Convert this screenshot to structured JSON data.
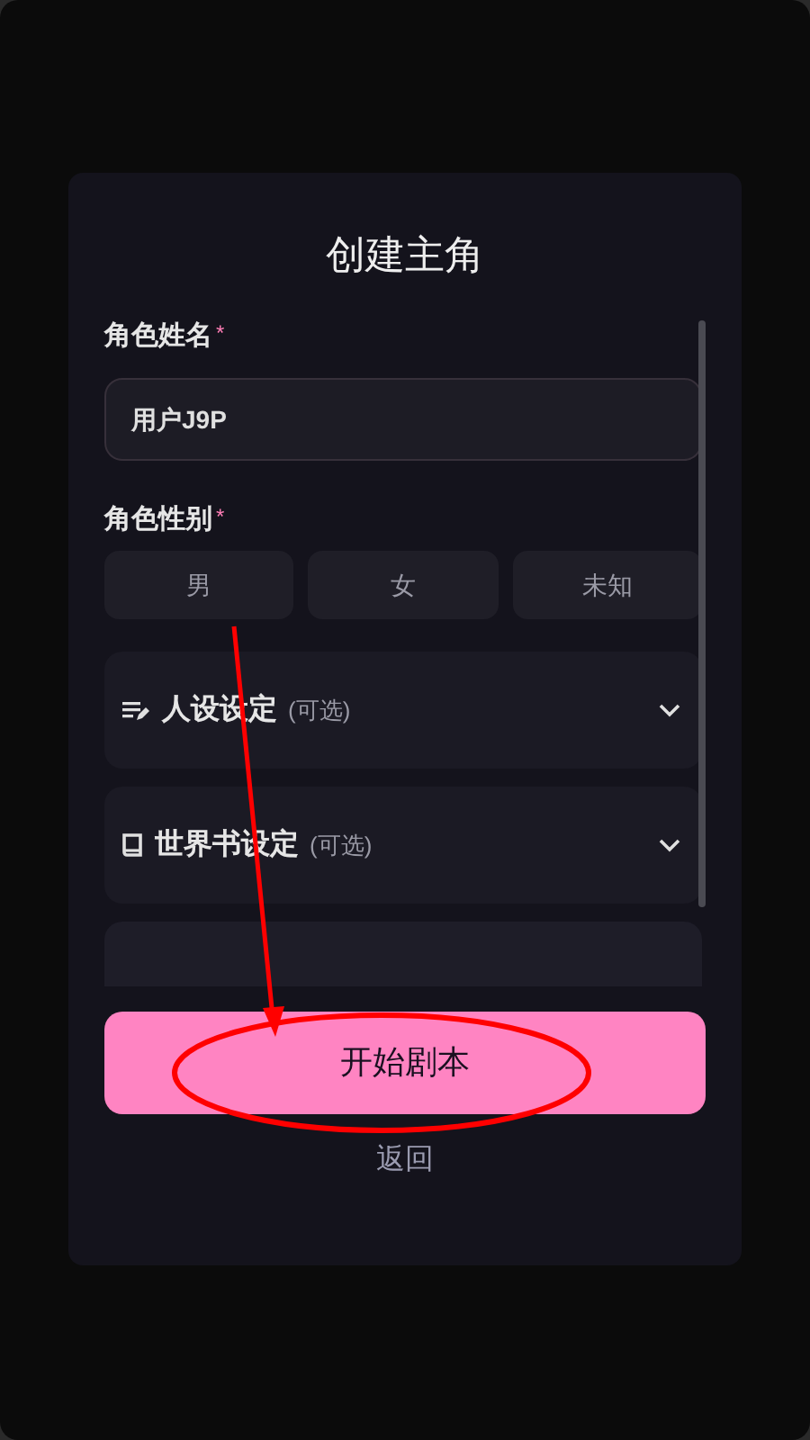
{
  "title": "创建主角",
  "name_field": {
    "label": "角色姓名",
    "required_mark": "*",
    "value": "用户J9P"
  },
  "gender_field": {
    "label": "角色性别",
    "required_mark": "*",
    "options": [
      {
        "label": "男",
        "selected": false
      },
      {
        "label": "女",
        "selected": false
      },
      {
        "label": "未知",
        "selected": false
      }
    ]
  },
  "sections": [
    {
      "kind": "persona",
      "title": "人设设定",
      "hint": "(可选)",
      "expanded": false
    },
    {
      "kind": "world",
      "title": "世界书设定",
      "hint": "(可选)",
      "expanded": false
    }
  ],
  "primary_button": "开始剧本",
  "back_link": "返回"
}
